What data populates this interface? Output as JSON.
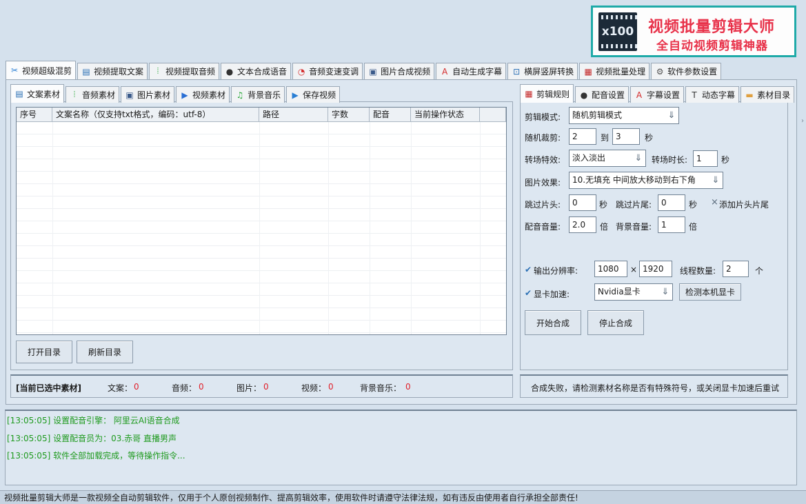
{
  "banner": {
    "logo_text": "x100",
    "title": "视频批量剪辑大师",
    "subtitle": "全自动视频剪辑神器"
  },
  "main_tabs": [
    {
      "label": "视频超级混剪",
      "icon": "scissors-icon",
      "glyph": "✂",
      "color": "#2a7fd4"
    },
    {
      "label": "视频提取文案",
      "icon": "document-icon",
      "glyph": "▤",
      "color": "#2a6fb4"
    },
    {
      "label": "视频提取音频",
      "icon": "audio-wave-icon",
      "glyph": "⦙",
      "color": "#2aa83a"
    },
    {
      "label": "文本合成语音",
      "icon": "microphone-icon",
      "glyph": "●",
      "color": "#333333"
    },
    {
      "label": "音频变速变调",
      "icon": "speed-gauge-icon",
      "glyph": "◔",
      "color": "#d42a2a"
    },
    {
      "label": "图片合成视频",
      "icon": "image-icon",
      "glyph": "▣",
      "color": "#3a5a8a"
    },
    {
      "label": "自动生成字幕",
      "icon": "subtitle-a-icon",
      "glyph": "A",
      "color": "#d42a2a"
    },
    {
      "label": "横屏竖屏转换",
      "icon": "rotate-screen-icon",
      "glyph": "⊡",
      "color": "#2a6fb4"
    },
    {
      "label": "视频批量处理",
      "icon": "film-icon",
      "glyph": "▦",
      "color": "#c42a2a"
    },
    {
      "label": "软件参数设置",
      "icon": "gear-icon",
      "glyph": "⚙",
      "color": "#555555"
    }
  ],
  "left_tabs": [
    {
      "label": "文案素材",
      "icon": "document-icon",
      "glyph": "▤",
      "color": "#2a6fb4"
    },
    {
      "label": "音频素材",
      "icon": "audio-wave-icon",
      "glyph": "⦙",
      "color": "#2aa83a"
    },
    {
      "label": "图片素材",
      "icon": "image-icon",
      "glyph": "▣",
      "color": "#3a5a8a"
    },
    {
      "label": "视频素材",
      "icon": "play-icon",
      "glyph": "▶",
      "color": "#2a6fd4"
    },
    {
      "label": "背景音乐",
      "icon": "music-note-icon",
      "glyph": "♫",
      "color": "#2aa83a"
    },
    {
      "label": "保存视频",
      "icon": "save-video-icon",
      "glyph": "▶",
      "color": "#2a7fd4"
    }
  ],
  "table": {
    "columns": [
      {
        "label": "序号"
      },
      {
        "label": "文案名称（仅支持txt格式，编码：utf-8）"
      },
      {
        "label": "路径"
      },
      {
        "label": "字数"
      },
      {
        "label": "配音"
      },
      {
        "label": "当前操作状态"
      },
      {
        "label": ""
      }
    ]
  },
  "buttons": {
    "open_dir": "打开目录",
    "refresh_dir": "刷新目录",
    "start": "开始合成",
    "stop": "停止合成",
    "detect_gpu": "检测本机显卡"
  },
  "selected_status": {
    "title": "[当前已选中素材]",
    "text_label": "文案：",
    "text_count": "0",
    "audio_label": "音频：",
    "audio_count": "0",
    "image_label": "图片：",
    "image_count": "0",
    "video_label": "视频：",
    "video_count": "0",
    "bgm_label": "背景音乐：",
    "bgm_count": "0"
  },
  "right_tabs": [
    {
      "label": "剪辑规则",
      "icon": "film-icon",
      "glyph": "▦",
      "color": "#c42a2a"
    },
    {
      "label": "配音设置",
      "icon": "microphone-icon",
      "glyph": "●",
      "color": "#333333"
    },
    {
      "label": "字幕设置",
      "icon": "subtitle-a-icon",
      "glyph": "A",
      "color": "#d42a2a"
    },
    {
      "label": "动态字幕",
      "icon": "text-t-icon",
      "glyph": "T",
      "color": "#333333"
    },
    {
      "label": "素材目录",
      "icon": "folder-icon",
      "glyph": "▬",
      "color": "#e0a040"
    }
  ],
  "settings": {
    "edit_mode_label": "剪辑模式:",
    "edit_mode_value": "随机剪辑模式",
    "random_cut_label": "随机裁剪:",
    "random_cut_from": "2",
    "to_label": "到",
    "random_cut_to": "3",
    "sec_label": "秒",
    "transition_label": "转场特效:",
    "transition_value": "淡入淡出",
    "transition_dur_label": "转场时长:",
    "transition_dur_value": "1",
    "image_effect_label": "图片效果:",
    "image_effect_value": "10.无填充 中间放大移动到右下角",
    "skip_head_label": "跳过片头:",
    "skip_head_value": "0",
    "skip_tail_label": "跳过片尾:",
    "skip_tail_value": "0",
    "add_head_tail_label": "添加片头片尾",
    "voice_vol_label": "配音音量:",
    "voice_vol_value": "2.0",
    "times_label": "倍",
    "bg_vol_label": "背景音量:",
    "bg_vol_value": "1",
    "resolution_label": "输出分辨率:",
    "res_w": "1080",
    "x_label": "×",
    "res_h": "1920",
    "threads_label": "线程数量:",
    "threads_value": "2",
    "unit_label": "个",
    "gpu_label": "显卡加速:",
    "gpu_value": "Nvidia显卡"
  },
  "error_message": "合成失败，请检测素材名称是否有特殊符号，或关闭显卡加速后重试",
  "log": [
    "[13:05:05] 设置配音引擎： 阿里云AI语音合成",
    "[13:05:05] 设置配音员为：03.赤哥 直播男声",
    "[13:05:05] 软件全部加载完成，等待操作指令..."
  ],
  "footer": "视频批量剪辑大师是一款视频全自动剪辑软件，仅用于个人原创视频制作、提高剪辑效率，使用软件时请遵守法律法规，如有违反由使用者自行承担全部责任!"
}
